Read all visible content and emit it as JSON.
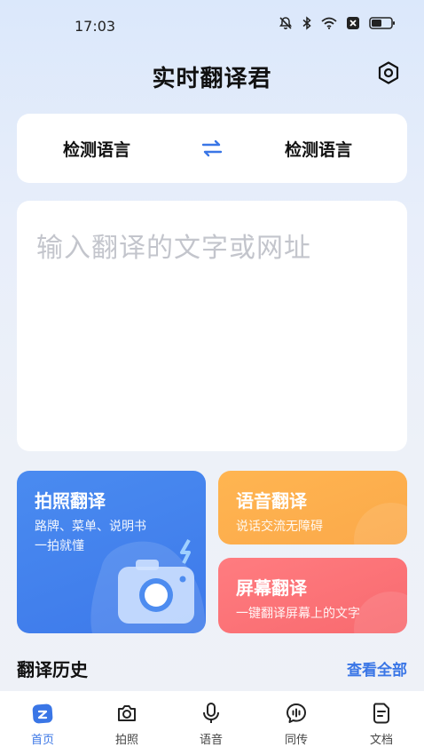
{
  "status": {
    "time": "17:03",
    "icons": [
      "mute-icon",
      "bluetooth-icon",
      "wifi-icon",
      "sim-off-icon",
      "battery-icon"
    ]
  },
  "header": {
    "title": "实时翻译君",
    "settings_icon": "settings-hex-icon"
  },
  "language": {
    "source": "检测语言",
    "target": "检测语言",
    "swap_icon": "swap-icon",
    "accent": "#3a76e6"
  },
  "input": {
    "placeholder": "输入翻译的文字或网址"
  },
  "features": {
    "photo": {
      "title": "拍照翻译",
      "line1": "路牌、菜单、说明书",
      "line2": "一拍就懂",
      "color": "#4a8bf0"
    },
    "voice": {
      "title": "语音翻译",
      "subtitle": "说话交流无障碍",
      "color": "#ffb551"
    },
    "screen": {
      "title": "屏幕翻译",
      "subtitle": "一键翻译屏幕上的文字",
      "color": "#ff7c80"
    }
  },
  "history": {
    "title": "翻译历史",
    "view_all": "查看全部"
  },
  "tabbar": {
    "tabs": [
      {
        "label": "首页",
        "icon": "home-icon",
        "active": true
      },
      {
        "label": "拍照",
        "icon": "camera-icon",
        "active": false
      },
      {
        "label": "语音",
        "icon": "microphone-icon",
        "active": false
      },
      {
        "label": "同传",
        "icon": "interpret-icon",
        "active": false
      },
      {
        "label": "文档",
        "icon": "document-icon",
        "active": false
      }
    ]
  }
}
